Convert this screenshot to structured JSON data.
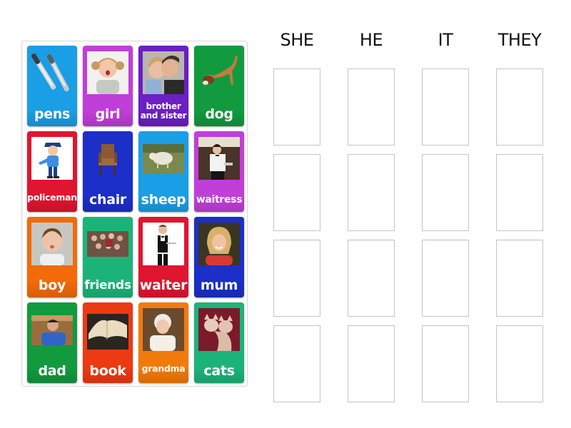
{
  "activity": {
    "type": "group sort",
    "columns": [
      {
        "title": "SHE"
      },
      {
        "title": "HE"
      },
      {
        "title": "IT"
      },
      {
        "title": "THEY"
      }
    ],
    "slots_per_column": 4
  },
  "cards": [
    {
      "label": "pens",
      "color": "#1a9ee6",
      "image": "pens-image"
    },
    {
      "label": "girl",
      "color": "#c03fd8",
      "image": "girl-photo"
    },
    {
      "label": "brother and sister",
      "color": "#6b1fc4",
      "image": "brother-and-sister-photo"
    },
    {
      "label": "dog",
      "color": "#129a3f",
      "image": "dog-photo"
    },
    {
      "label": "policeman",
      "color": "#e01530",
      "image": "policeman-cartoon"
    },
    {
      "label": "chair",
      "color": "#1c2fc8",
      "image": "chair-photo"
    },
    {
      "label": "sheep",
      "color": "#1a9ee6",
      "image": "sheep-photo"
    },
    {
      "label": "waitress",
      "color": "#c03fd8",
      "image": "waitress-photo"
    },
    {
      "label": "boy",
      "color": "#f26a0a",
      "image": "boy-photo"
    },
    {
      "label": "friends",
      "color": "#1cb37a",
      "image": "friends-photo"
    },
    {
      "label": "waiter",
      "color": "#e01530",
      "image": "waiter-photo"
    },
    {
      "label": "mum",
      "color": "#1c2fc8",
      "image": "mum-photo"
    },
    {
      "label": "dad",
      "color": "#129a3f",
      "image": "dad-photo"
    },
    {
      "label": "book",
      "color": "#ec3a12",
      "image": "book-photo"
    },
    {
      "label": "grandma",
      "color": "#f27a0a",
      "image": "grandma-photo"
    },
    {
      "label": "cats",
      "color": "#1cb37a",
      "image": "cats-photo"
    }
  ]
}
